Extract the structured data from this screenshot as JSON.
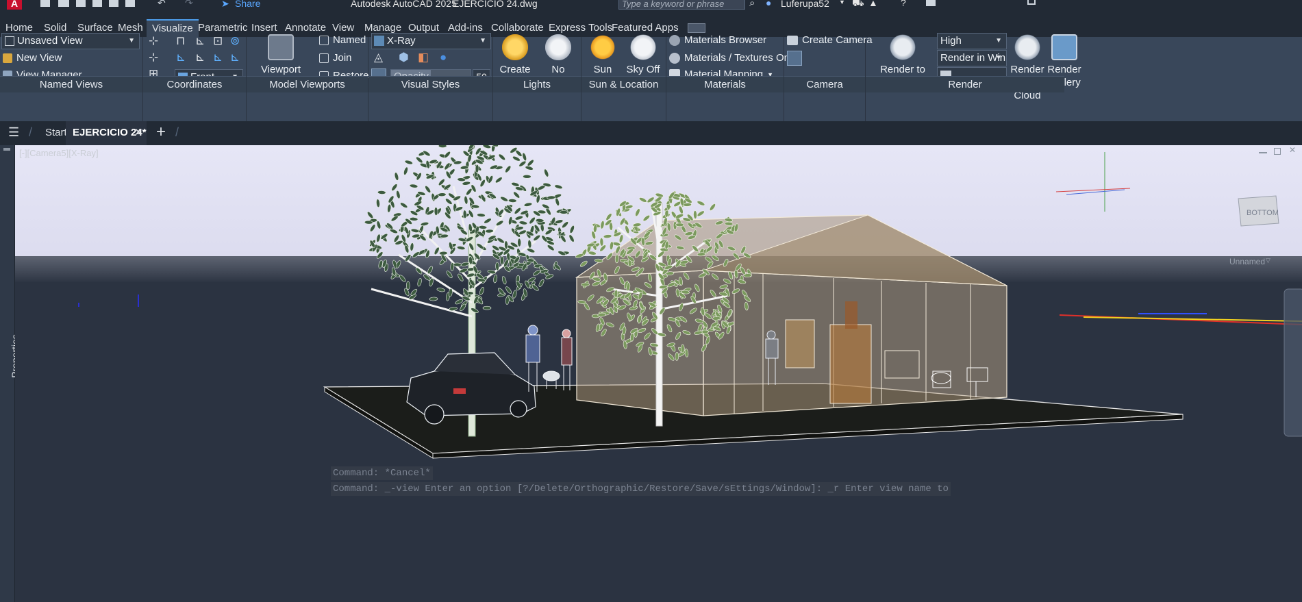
{
  "title_bar": {
    "app_title": "Autodesk AutoCAD 2025",
    "file_name": "EJERCICIO 24.dwg",
    "share_label": "Share",
    "search_placeholder": "Type a keyword or phrase",
    "user_name": "Luferupa52"
  },
  "ribbon_tabs": [
    "Home",
    "Solid",
    "Surface",
    "Mesh",
    "Visualize",
    "Parametric",
    "Insert",
    "Annotate",
    "View",
    "Manage",
    "Output",
    "Add-ins",
    "Collaborate",
    "Express Tools",
    "Featured Apps"
  ],
  "active_tab": "Visualize",
  "panels": {
    "named_views": {
      "title": "Named Views",
      "current_view": "Unsaved View",
      "new_view": "New View",
      "view_manager": "View Manager"
    },
    "coordinates": {
      "title": "Coordinates",
      "ucs_value": "Front"
    },
    "model_viewports": {
      "title": "Model Viewports",
      "viewport_config": "Viewport Configuration",
      "named": "Named",
      "join": "Join",
      "restore": "Restore"
    },
    "visual_styles": {
      "title": "Visual Styles",
      "style_value": "X-Ray",
      "opacity_label": "Opacity",
      "opacity_value": "50"
    },
    "lights": {
      "title": "Lights",
      "create_light": "Create Light",
      "no_shadows": "No Shadows"
    },
    "sun_location": {
      "title": "Sun & Location",
      "sun_status": "Sun Status",
      "sky_off": "Sky Off"
    },
    "materials": {
      "title": "Materials",
      "materials_browser": "Materials Browser",
      "materials_textures": "Materials / Textures On",
      "material_mapping": "Material Mapping"
    },
    "camera": {
      "title": "Camera",
      "create_camera": "Create Camera"
    },
    "render": {
      "title": "Render",
      "render_to_size": "Render to Size",
      "quality_value": "High",
      "render_target": "Render in Win...",
      "render_cloud": "Render in Cloud",
      "render_gallery": "Render Gallery"
    }
  },
  "doc_tabs": {
    "start": "Start",
    "active_doc": "EJERCICIO 24*"
  },
  "viewport": {
    "label": "[-][Camera5][X-Ray]",
    "viewcube_face": "BOTTOM",
    "unnamed_label": "Unnamed",
    "properties_label": "Properties"
  },
  "command_history": [
    "Command: *Cancel*",
    "Command: _-view Enter an option [?/Delete/Orthographic/Restore/Save/sEttings/Window]: _r Enter view name to"
  ],
  "colors": {
    "ribbon_bg": "#39475a",
    "titlebar_bg": "#222a35",
    "sky": "#e9e9f7",
    "ground": "#2b3341",
    "accent": "#4c9be8"
  }
}
